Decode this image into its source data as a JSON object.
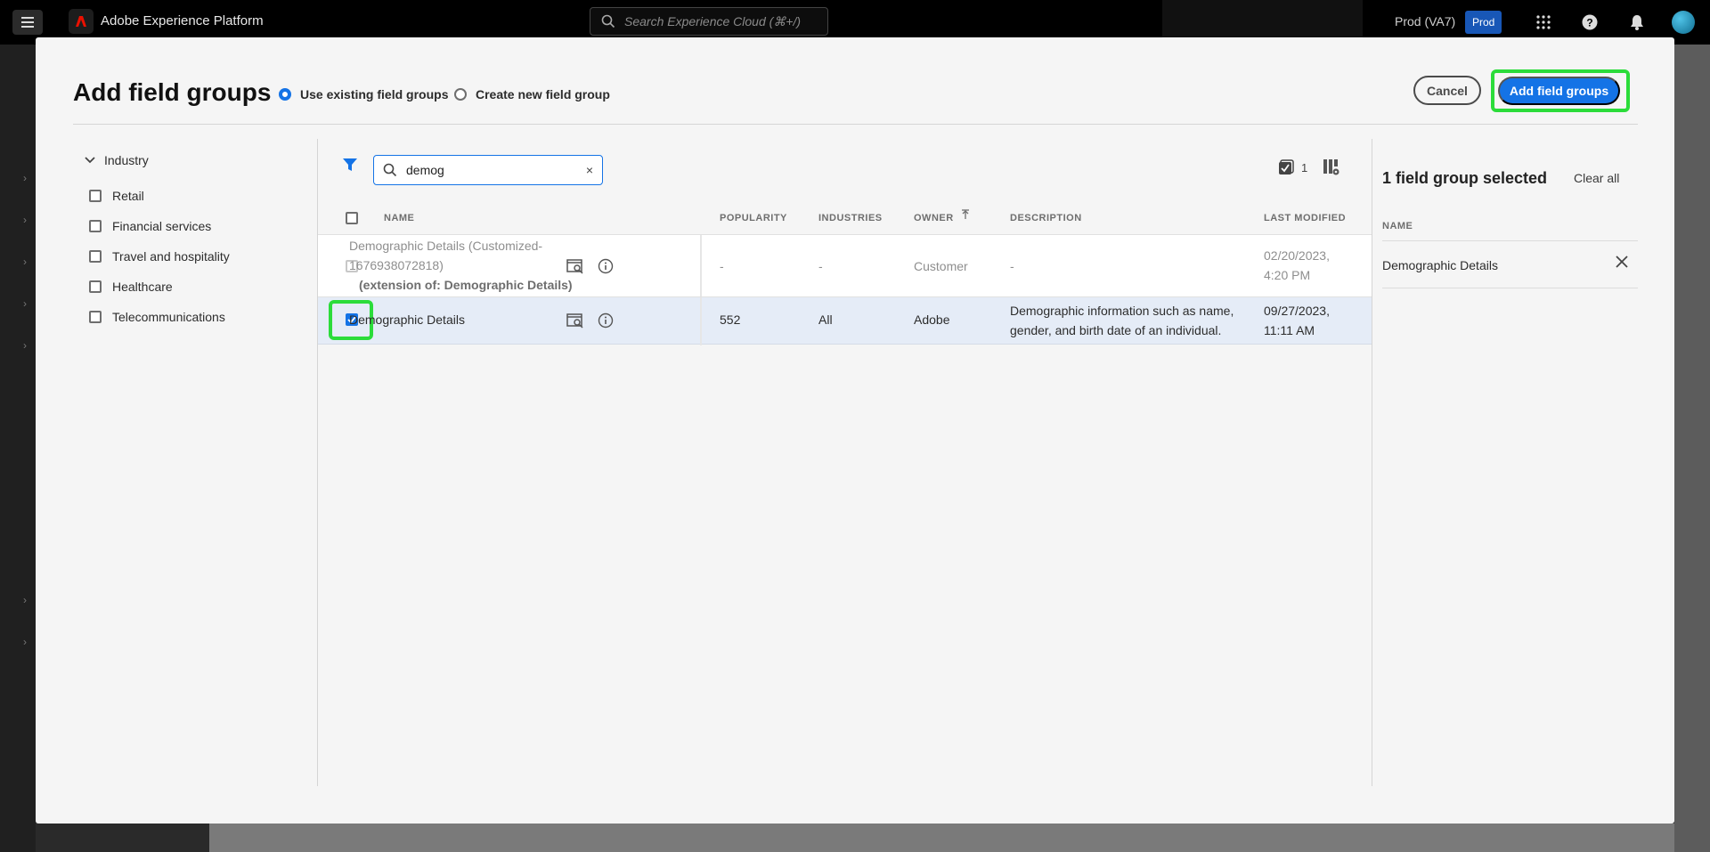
{
  "topbar": {
    "app_title": "Adobe Experience Platform",
    "search_placeholder": "Search Experience Cloud (⌘+/)",
    "env_label": "Prod (VA7)",
    "env_badge": "Prod"
  },
  "modal": {
    "title": "Add field groups",
    "radio_existing": "Use existing field groups",
    "radio_new": "Create new field group",
    "cancel_label": "Cancel",
    "add_label": "Add field groups"
  },
  "filters": {
    "heading": "Industry",
    "items": [
      "Retail",
      "Financial services",
      "Travel and hospitality",
      "Healthcare",
      "Telecommunications"
    ]
  },
  "search": {
    "value": "demog",
    "clear": "×"
  },
  "selection_count": "1",
  "table": {
    "headers": {
      "name": "NAME",
      "popularity": "POPULARITY",
      "industries": "INDUSTRIES",
      "owner": "OWNER",
      "description": "DESCRIPTION",
      "last_modified": "LAST MODIFIED"
    },
    "rows": [
      {
        "name_line1": "Demographic Details (Customized-",
        "name_line2": "1676938072818)",
        "extension": "(extension of: Demographic Details)",
        "popularity": "-",
        "industries": "-",
        "owner": "Customer",
        "description": "-",
        "modified_line1": "02/20/2023,",
        "modified_line2": "4:20 PM",
        "checked": false
      },
      {
        "name": "Demographic Details",
        "popularity": "552",
        "industries": "All",
        "owner": "Adobe",
        "description_line1": "Demographic information such as name,",
        "description_line2": "gender, and birth date of an individual.",
        "modified_line1": "09/27/2023,",
        "modified_line2": "11:11 AM",
        "checked": true
      }
    ]
  },
  "selected_panel": {
    "title": "1 field group selected",
    "clear_all": "Clear all",
    "column": "NAME",
    "items": [
      "Demographic Details"
    ]
  },
  "colors": {
    "accent": "#1473e6",
    "highlight": "#2bdc3a",
    "brand": "#eb1000"
  }
}
